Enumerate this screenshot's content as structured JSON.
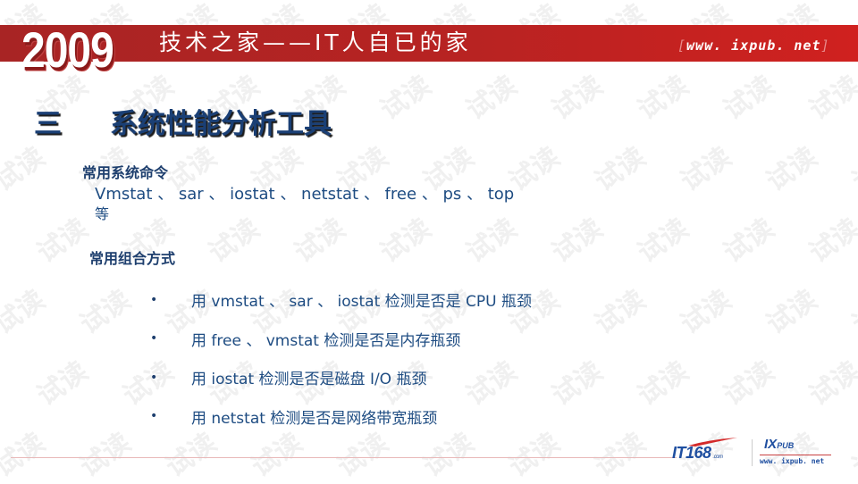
{
  "header": {
    "year": "2009",
    "title": "技术之家——IT人自已的家",
    "url_open_bracket": "[",
    "url": "www. ixpub. net",
    "url_close_bracket": "]",
    "colors": {
      "banner": "#b82322",
      "banner_text": "#ffffff"
    }
  },
  "slide": {
    "section_number": "三",
    "title": "系统性能分析工具",
    "title_color": "#1a3f75",
    "common_commands": {
      "heading": "常用系统命令",
      "commands_line": "Vmstat 、 sar 、 iostat 、 netstat 、 free 、 ps 、 top",
      "suffix": "等"
    },
    "common_combinations": {
      "heading": "常用组合方式",
      "bullet": "•",
      "items": [
        "用 vmstat 、 sar 、 iostat 检测是否是 CPU 瓶颈",
        "用 free 、 vmstat 检测是否是内存瓶颈",
        "用 iostat 检测是否是磁盘 I/O 瓶颈",
        "用 netstat 检测是否是网络带宽瓶颈"
      ]
    },
    "text_color": "#1e4c82"
  },
  "watermark": {
    "text": "试读"
  },
  "footer": {
    "logo_it168": {
      "it": "IT",
      "number": "168",
      "suffix": ".com"
    },
    "logo_ixpub": {
      "ix": "IX",
      "pub": "PUB",
      "url": "www. ixpub. net"
    }
  }
}
